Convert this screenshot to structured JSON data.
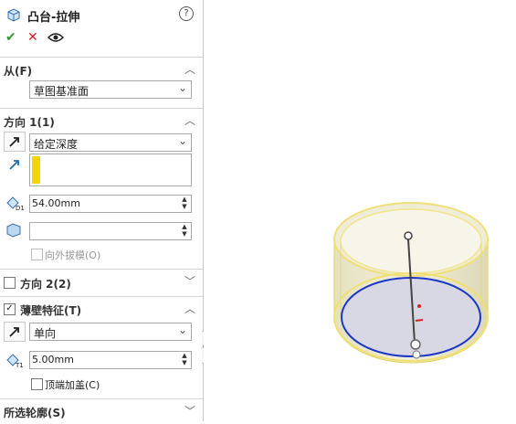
{
  "header": {
    "title": "凸台-拉伸",
    "help": "?"
  },
  "toolbar": {
    "ok": "✔",
    "cancel": "✕",
    "preview": "👁"
  },
  "from_section": {
    "label": "从(F)",
    "value": "草图基准面"
  },
  "direction1": {
    "label": "方向 1(1)",
    "end_condition": "给定深度",
    "depth": "54.00mm",
    "draft_label": "向外拔模(O)"
  },
  "direction2": {
    "label": "方向 2(2)"
  },
  "thin_feature": {
    "label": "薄壁特征(T)",
    "type": "单向",
    "thickness": "5.00mm",
    "cap_label": "顶端加盖(C)"
  },
  "selected_contours": {
    "label": "所选轮廓(S)"
  },
  "colors": {
    "accent_yellow": "#f5d400",
    "blue_edge": "#1a37c8",
    "body_fill": "#ede9cf"
  },
  "icons": [
    "extrude-icon",
    "help-icon",
    "ok-icon",
    "cancel-icon",
    "eye-icon",
    "direction-arrow-icon",
    "reverse-direction-icon",
    "depth-icon",
    "draft-icon",
    "thickness-icon"
  ]
}
